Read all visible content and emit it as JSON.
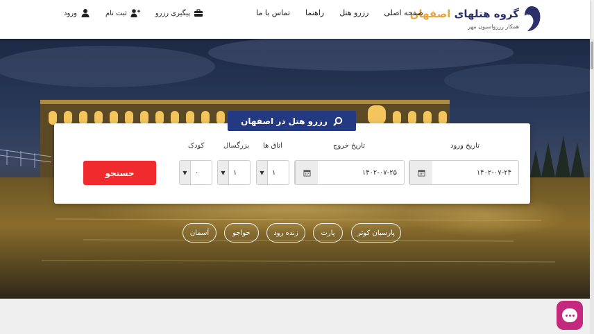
{
  "header": {
    "logo_title_main": "گروه هتلهای",
    "logo_title_accent": "اصفهان",
    "logo_subtitle": "همکار رزرواسیون مهر",
    "nav": [
      "صفحه اصلی",
      "رزرو هتل",
      "راهنما",
      "تماس با ما"
    ],
    "user_links": {
      "track": "پیگیری رزرو",
      "register": "ثبت نام",
      "login": "ورود"
    }
  },
  "booking": {
    "tab_label": "رزرو هتل در اصفهان",
    "checkin_label": "تاریخ ورود",
    "checkin_value": "۱۴۰۲-۰۷-۲۴",
    "checkout_label": "تاریخ خروج",
    "checkout_value": "۱۴۰۲-۰۷-۲۵",
    "rooms_label": "اتاق ها",
    "rooms_value": "۱",
    "adults_label": "بزرگسال",
    "adults_value": "۱",
    "children_label": "کودک",
    "children_value": "۰",
    "search_label": "جستجو"
  },
  "hotels": [
    "پارسیان کوثر",
    "پارت",
    "زنده رود",
    "خواجو",
    "آسمان"
  ],
  "colors": {
    "brand_navy": "#233a82",
    "accent_orange": "#e6a43a",
    "search_red": "#f02a2d",
    "chat_magenta": "#c4297e"
  },
  "icons": [
    "logo-emblem-icon",
    "briefcase-icon",
    "user-plus-icon",
    "user-icon",
    "search-icon",
    "calendar-icon",
    "chevron-down-icon",
    "chat-icon"
  ]
}
